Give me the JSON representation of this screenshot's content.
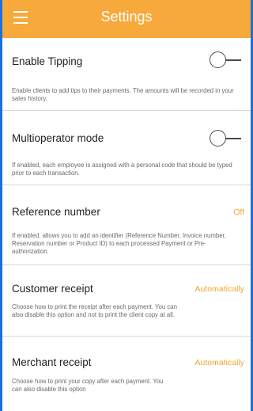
{
  "appbar": {
    "title": "Settings"
  },
  "settings": [
    {
      "title": "Enable Tipping",
      "description": "Enable clients to add tips to their payments. The amounts will be recorded in your sales history.",
      "control": "toggle",
      "toggle_on": false
    },
    {
      "title": "Multioperator mode",
      "description": "If enabled, each employee is assigned with a personal code that should be typed prior to each transaction.",
      "control": "toggle",
      "toggle_on": false
    },
    {
      "title": "Reference number",
      "value": "Off",
      "description": "If enabled, allows you to add an identifier (Reference Number, Invoice number, Reservation number or Product ID) to each processed Payment or Pre-authorization.",
      "control": "value"
    },
    {
      "title": "Customer receipt",
      "value": "Automatically",
      "description": "Choose how to print the receipt after each payment. You can also disable this option and not to print the client copy at all.",
      "control": "value"
    },
    {
      "title": "Merchant receipt",
      "value": "Automatically",
      "description": "Choose how to print your copy after each payment. You can also disable this option",
      "control": "value"
    }
  ],
  "colors": {
    "appbar": "#f7a93b",
    "accent_value": "#f2a532",
    "frame_border": "#1e6fd9"
  },
  "icons": {
    "menu": "hamburger-menu-icon"
  }
}
